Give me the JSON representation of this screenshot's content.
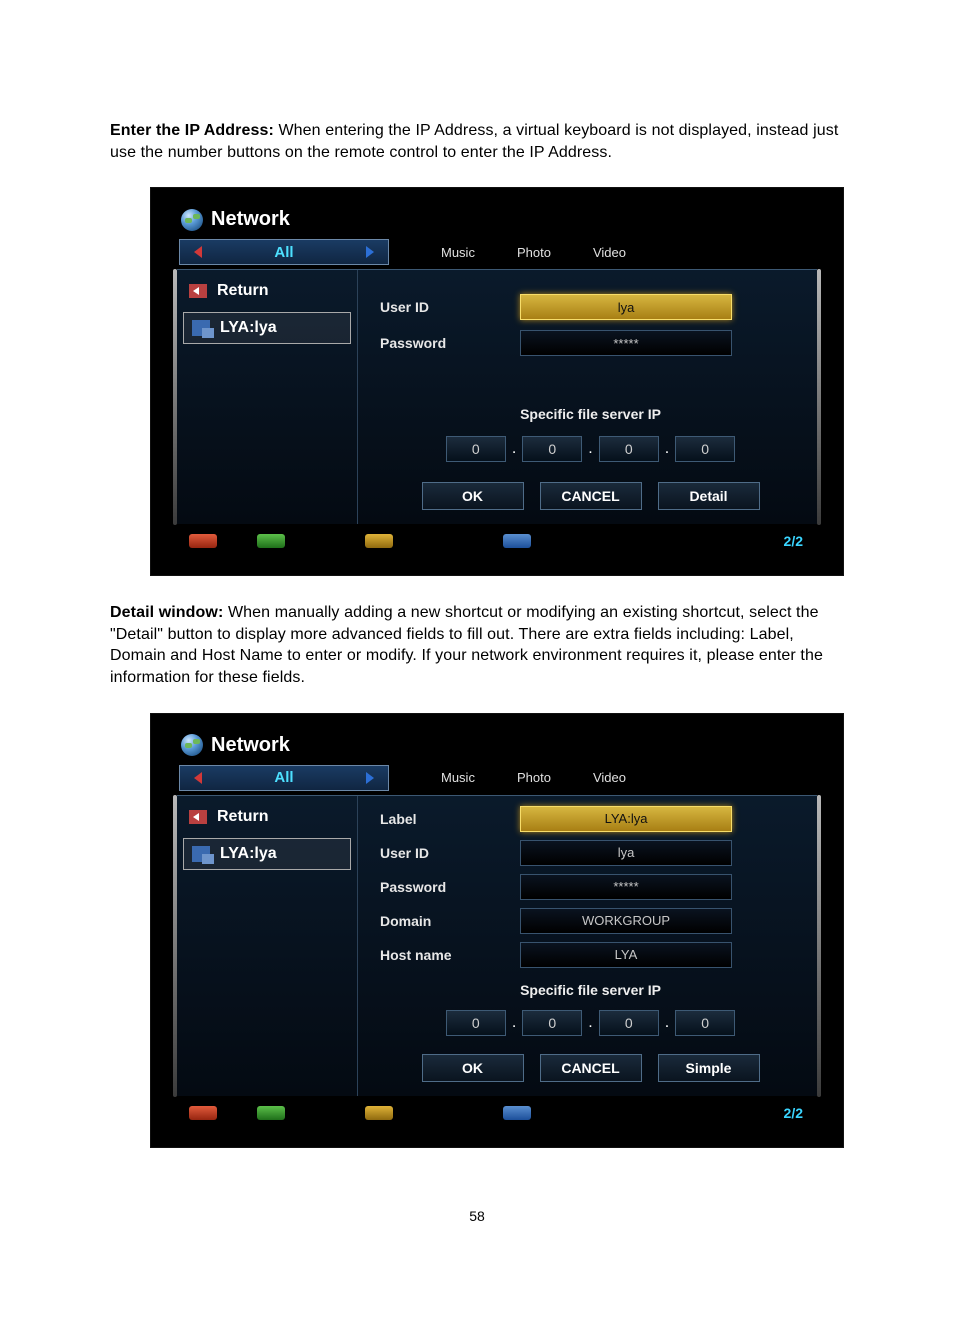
{
  "para1": {
    "bold": "Enter the IP Address:",
    "rest": " When entering the IP Address, a virtual keyboard is not displayed, instead just use the number buttons on the remote control to enter the IP Address."
  },
  "para2": {
    "bold": "Detail window:",
    "rest": " When manually adding a new shortcut or modifying an existing shortcut, select the \"Detail\" button to display more advanced fields to fill out. There are extra fields including: Label, Domain and Host Name to enter or modify. If your network environment requires it, please enter the information for these fields."
  },
  "page_number": "58",
  "screenshot1": {
    "title": "Network",
    "tabs": {
      "active": "All",
      "others": [
        "Music",
        "Photo",
        "Video"
      ]
    },
    "sidebar": {
      "return": "Return",
      "selected_item": "LYA:lya"
    },
    "form": {
      "user_id_label": "User ID",
      "user_id_value": "lya",
      "password_label": "Password",
      "password_value": "*****",
      "specific_label": "Specific file server IP",
      "ip": [
        "0",
        "0",
        "0",
        "0"
      ],
      "buttons": {
        "ok": "OK",
        "cancel": "CANCEL",
        "detail": "Detail"
      }
    },
    "footer_pager": "2/2"
  },
  "screenshot2": {
    "title": "Network",
    "tabs": {
      "active": "All",
      "others": [
        "Music",
        "Photo",
        "Video"
      ]
    },
    "sidebar": {
      "return": "Return",
      "selected_item": "LYA:lya"
    },
    "form": {
      "label_label": "Label",
      "label_value": "LYA:lya",
      "user_id_label": "User ID",
      "user_id_value": "lya",
      "password_label": "Password",
      "password_value": "*****",
      "domain_label": "Domain",
      "domain_value": "WORKGROUP",
      "host_label": "Host name",
      "host_value": "LYA",
      "specific_label": "Specific file server IP",
      "ip": [
        "0",
        "0",
        "0",
        "0"
      ],
      "buttons": {
        "ok": "OK",
        "cancel": "CANCEL",
        "simple": "Simple"
      }
    },
    "footer_pager": "2/2"
  }
}
